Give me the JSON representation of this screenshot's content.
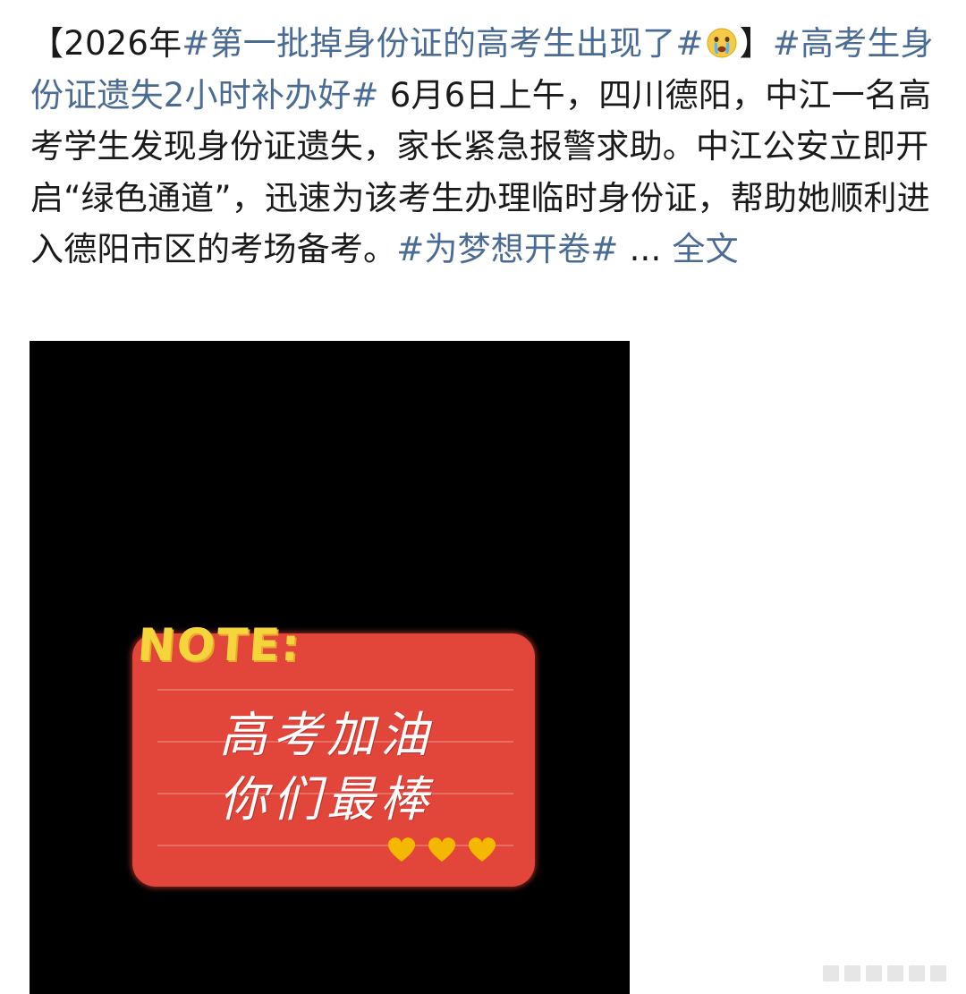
{
  "post": {
    "bracket_open": "【",
    "year_prefix": "2026年",
    "topic1": "#第一批掉身份证的高考生出现了#",
    "emoji_icon": "crying-face-emoji",
    "bracket_close": "】",
    "topic2": "#高考生身份证遗失2小时补办好#",
    "body_part1": " 6月6日上午，四川德阳，中江一名高考学生发现身份证遗失，家长紧急报警求助。中江公安立即开启“绿色通道”，迅速为该考生办理临时身份证，帮助她顺利进入德阳市区的考场备考。",
    "topic3": "#为梦想开卷#",
    "ellipsis": " ... ",
    "full_text_link": "全文"
  },
  "image": {
    "note_label": "NOTE:",
    "line1": "高考加油",
    "line2": "你们最棒"
  },
  "colors": {
    "link": "#4a6b94",
    "text": "#1a1a1a",
    "card": "#e2453a",
    "note_yellow": "#f6d53c",
    "heart_yellow": "#f5b800"
  }
}
